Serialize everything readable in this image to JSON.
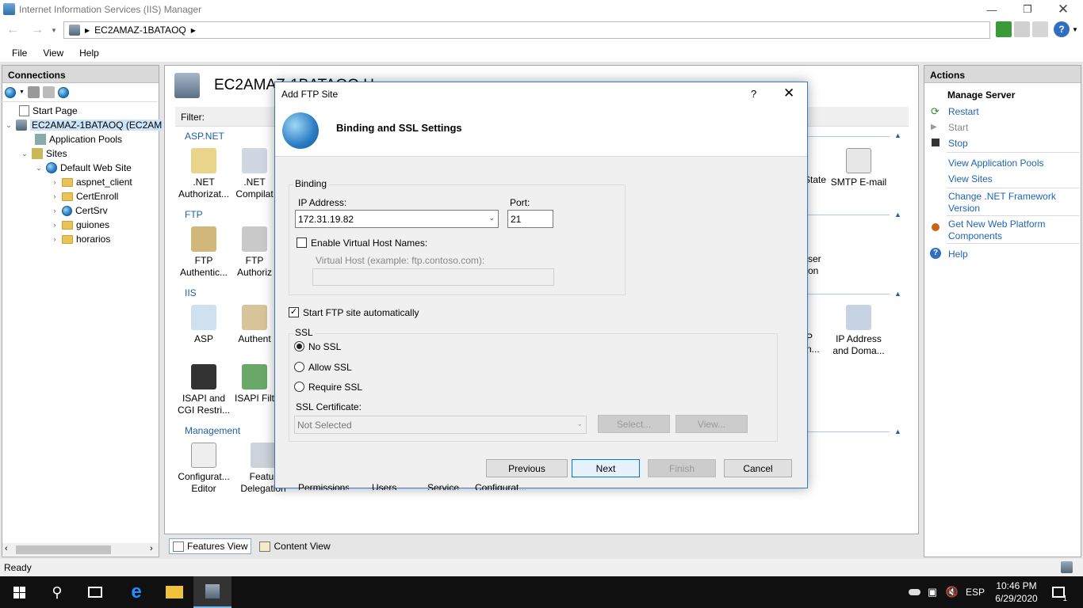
{
  "window": {
    "title": "Internet Information Services (IIS) Manager"
  },
  "address": {
    "crumbs": [
      "EC2AMAZ-1BATAOQ"
    ]
  },
  "menu": [
    "File",
    "View",
    "Help"
  ],
  "connections": {
    "title": "Connections",
    "tree": [
      {
        "label": "Start Page"
      },
      {
        "label": "EC2AMAZ-1BATAOQ (EC2AM"
      },
      {
        "label": "Application Pools"
      },
      {
        "label": "Sites"
      },
      {
        "label": "Default Web Site"
      },
      {
        "label": "aspnet_client"
      },
      {
        "label": "CertEnroll"
      },
      {
        "label": "CertSrv"
      },
      {
        "label": "guiones"
      },
      {
        "label": "horarios"
      }
    ]
  },
  "center": {
    "title": "EC2AMAZ-1BATAOQ H",
    "filter_label": "Filter:",
    "groups": {
      "aspnet": "ASP.NET",
      "ftp": "FTP",
      "iis": "IIS",
      "management": "Management"
    },
    "features": {
      "net_auth": [
        ".NET",
        "Authorizat..."
      ],
      "net_comp": [
        ".NET",
        "Compilat"
      ],
      "state": "State",
      "smtp": "SMTP E-mail",
      "ftp_auth": [
        "FTP",
        "Authentic..."
      ],
      "ftp_authz": [
        "FTP",
        "Authoriz"
      ],
      "user_iso": [
        "ser",
        "on"
      ],
      "asp": "ASP",
      "authent": "Authent",
      "ip_domain": [
        "IP Address",
        "and Doma..."
      ],
      "iis_p": [
        "P",
        "n..."
      ],
      "isapi_cgi": [
        "ISAPI and",
        "CGI Restri..."
      ],
      "isapi_filt": "ISAPI Filt",
      "config_editor": [
        "Configurat...",
        "Editor"
      ],
      "feat_deleg": [
        "Featur",
        "Delegation"
      ],
      "permissions": "Permissions",
      "users": "Users",
      "service": "Service",
      "configurat2": "Configurat..."
    },
    "view_tabs": {
      "features": "Features View",
      "content": "Content View"
    }
  },
  "actions": {
    "title": "Actions",
    "manage_server": "Manage Server",
    "restart": "Restart",
    "start": "Start",
    "stop": "Stop",
    "view_app_pools": "View Application Pools",
    "view_sites": "View Sites",
    "change_net": "Change .NET Framework Version",
    "get_new": "Get New Web Platform Components",
    "help": "Help"
  },
  "status": "Ready",
  "taskbar": {
    "lang": "ESP",
    "time": "10:46 PM",
    "date": "6/29/2020",
    "notif_count": "1"
  },
  "dialog": {
    "title": "Add FTP Site",
    "help_glyph": "?",
    "header": "Binding and SSL Settings",
    "binding_legend": "Binding",
    "ip_label": "IP Address:",
    "ip_value": "172.31.19.82",
    "port_label": "Port:",
    "port_value": "21",
    "vhost_check_label": "Enable Virtual Host Names:",
    "vhost_label": "Virtual Host (example: ftp.contoso.com):",
    "vhost_value": "",
    "autostart_label": "Start FTP site automatically",
    "autostart_checked": true,
    "ssl_legend": "SSL",
    "ssl_options": [
      "No SSL",
      "Allow SSL",
      "Require SSL"
    ],
    "ssl_selected": "No SSL",
    "cert_label": "SSL Certificate:",
    "cert_value": "Not Selected",
    "select_btn": "Select...",
    "view_btn": "View...",
    "buttons": {
      "previous": "Previous",
      "next": "Next",
      "finish": "Finish",
      "cancel": "Cancel"
    }
  },
  "colors": {
    "accent": "#0078d7",
    "link": "#1f63b4",
    "group": "#1f5ea8"
  }
}
